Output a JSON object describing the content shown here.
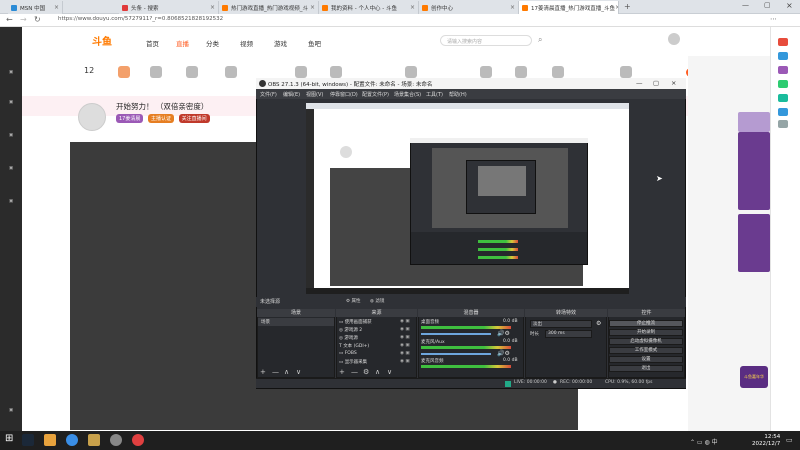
{
  "browser": {
    "tabs": [
      {
        "label": "MSN 中国"
      },
      {
        "label": "头条 - 搜索"
      },
      {
        "label": "热门游戏直播_热门游戏视频_斗"
      },
      {
        "label": "我的资料 - 个人中心 - 斗鱼"
      },
      {
        "label": "创作中心"
      },
      {
        "label": "17姜清晨直播_热门游戏直播_斗鱼"
      }
    ],
    "url": "https://www.douyu.com/5727911?_r=0.8068521828192532"
  },
  "douyu": {
    "logo": "斗鱼",
    "nav": [
      "首页",
      "直播",
      "分类",
      "视频",
      "游戏",
      "鱼吧"
    ],
    "search_placeholder": "请输入搜索内容",
    "streamer_title": "开始努力！ （双倍亲密度）",
    "tags": [
      "17姜清晨",
      "主播认证",
      "关注直播间"
    ],
    "right_badge": "PC客户端",
    "right_text": "斗鱼嘉年华",
    "level": "12"
  },
  "obs": {
    "title": "OBS 27.1.3 (64-bit, windows) - 配置文件: 未命名 - 场景: 未命名",
    "menu": [
      "文件(F)",
      "编辑(E)",
      "视图(V)",
      "停靠窗口(D)",
      "配置文件(P)",
      "场景集合(S)",
      "工具(T)",
      "帮助(H)"
    ],
    "no_source": "未选择源",
    "props_btn": "属性",
    "filters_btn": "滤镜",
    "docks": {
      "scenes": "场景",
      "sources": "来源",
      "mixer": "混音器",
      "transitions": "转场特效",
      "controls": "控件"
    },
    "scenes": [
      "场景"
    ],
    "sources": [
      "使用画面捕获",
      "游戏源 2",
      "游戏源",
      "文本 (GDI+)",
      "FOBS",
      "显示器采集"
    ],
    "mixer": [
      {
        "name": "桌面音频",
        "level": "0.0 dB"
      },
      {
        "name": "麦克风/Aux",
        "level": "0.0 dB"
      },
      {
        "name": "麦克风音频",
        "level": "0.0 dB"
      }
    ],
    "transition": "淡出",
    "duration_label": "时长",
    "duration": "300 ms",
    "controls": [
      "停止推流",
      "开始录制",
      "启动虚拟摄像机",
      "工作室模式",
      "设置",
      "退出"
    ],
    "status": {
      "live": "LIVE: 00:00:00",
      "rec": "REC: 00:00:00",
      "cpu": "CPU: 0.9%, 60.00 fps"
    }
  },
  "taskbar": {
    "time": "12:54",
    "date": "2022/12/7"
  }
}
